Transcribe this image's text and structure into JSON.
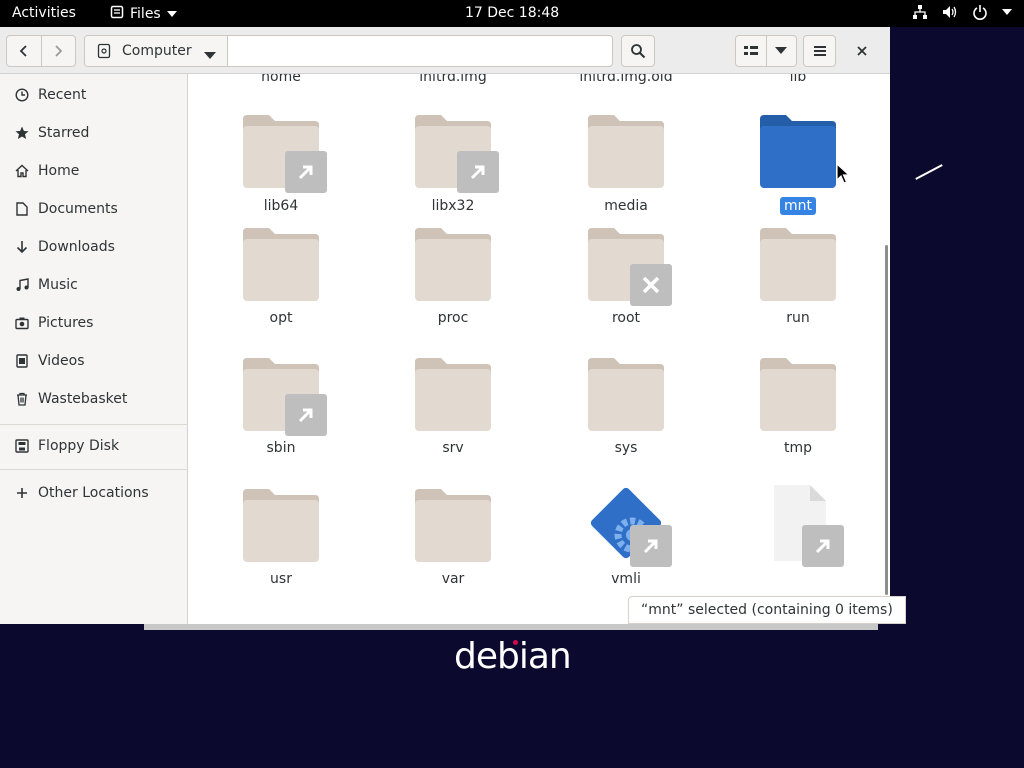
{
  "topbar": {
    "activities": "Activities",
    "app_name": "Files",
    "clock": "17 Dec  18:48"
  },
  "header": {
    "path_segment": "Computer"
  },
  "sidebar": {
    "items": [
      {
        "label": "Recent",
        "icon": "clock-icon"
      },
      {
        "label": "Starred",
        "icon": "star-icon"
      },
      {
        "label": "Home",
        "icon": "home-icon"
      },
      {
        "label": "Documents",
        "icon": "document-icon"
      },
      {
        "label": "Downloads",
        "icon": "download-icon"
      },
      {
        "label": "Music",
        "icon": "music-icon"
      },
      {
        "label": "Pictures",
        "icon": "camera-icon"
      },
      {
        "label": "Videos",
        "icon": "video-icon"
      },
      {
        "label": "Wastebasket",
        "icon": "trash-icon"
      },
      {
        "label": "Floppy Disk",
        "icon": "floppy-icon"
      },
      {
        "label": "Other Locations",
        "icon": "plus-icon"
      }
    ]
  },
  "files": {
    "top_row": [
      "home",
      "initrd.img",
      "initrd.img.old",
      "lib"
    ],
    "items": [
      {
        "name": "lib64",
        "type": "folder",
        "badge": "link"
      },
      {
        "name": "libx32",
        "type": "folder",
        "badge": "link"
      },
      {
        "name": "media",
        "type": "folder",
        "badge": ""
      },
      {
        "name": "mnt",
        "type": "folder",
        "badge": "",
        "selected": true
      },
      {
        "name": "opt",
        "type": "folder",
        "badge": ""
      },
      {
        "name": "proc",
        "type": "folder",
        "badge": ""
      },
      {
        "name": "root",
        "type": "folder",
        "badge": "locked"
      },
      {
        "name": "run",
        "type": "folder",
        "badge": ""
      },
      {
        "name": "sbin",
        "type": "folder",
        "badge": "link"
      },
      {
        "name": "srv",
        "type": "folder",
        "badge": ""
      },
      {
        "name": "sys",
        "type": "folder",
        "badge": ""
      },
      {
        "name": "tmp",
        "type": "folder",
        "badge": ""
      },
      {
        "name": "usr",
        "type": "folder",
        "badge": ""
      },
      {
        "name": "var",
        "type": "folder",
        "badge": ""
      },
      {
        "name": "vmli",
        "type": "executable",
        "badge": "link"
      },
      {
        "name": "",
        "type": "file",
        "badge": "link"
      }
    ]
  },
  "status": "“mnt” selected  (containing 0 items)",
  "desktop": {
    "logo_text": "debian"
  },
  "colors": {
    "folder": "#e2d9d0",
    "folder_tab": "#cfc3b8",
    "selected_folder": "#2f6fc7",
    "selection": "#3584e4"
  }
}
